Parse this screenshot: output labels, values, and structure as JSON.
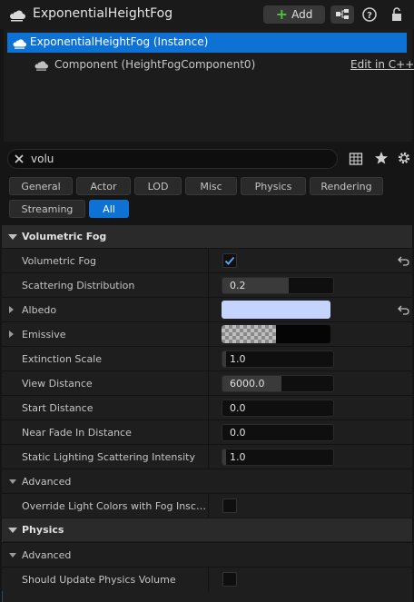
{
  "header": {
    "title": "ExponentialHeightFog",
    "add_label": "Add"
  },
  "tree": {
    "instance_label": "ExponentialHeightFog (Instance)",
    "component_label": "Component (HeightFogComponent0)",
    "edit_link": "Edit in C++"
  },
  "search": {
    "value": "volu"
  },
  "filter_tabs": [
    "General",
    "Actor",
    "LOD",
    "Misc",
    "Physics",
    "Rendering",
    "Streaming",
    "All"
  ],
  "active_tab": "All",
  "details": {
    "volumetric_fog": {
      "category": "Volumetric Fog",
      "volumetric_fog_label": "Volumetric Fog",
      "volumetric_fog_checked": true,
      "scattering_label": "Scattering Distribution",
      "scattering_value": "0.2",
      "albedo_label": "Albedo",
      "albedo_color": "#c4d4ff",
      "emissive_label": "Emissive",
      "extinction_label": "Extinction Scale",
      "extinction_value": "1.0",
      "view_distance_label": "View Distance",
      "view_distance_value": "6000.0",
      "start_distance_label": "Start Distance",
      "start_distance_value": "0.0",
      "near_fade_label": "Near Fade In Distance",
      "near_fade_value": "0.0",
      "static_lighting_label": "Static Lighting Scattering Intensity",
      "static_lighting_value": "1.0",
      "advanced_label": "Advanced",
      "override_label": "Override Light Colors with Fog Inscatte..."
    },
    "physics": {
      "category": "Physics",
      "advanced_label": "Advanced",
      "update_volume_label": "Should Update Physics Volume"
    }
  },
  "colors": {
    "accent": "#0d72d3",
    "add_plus": "#4fc23a"
  }
}
